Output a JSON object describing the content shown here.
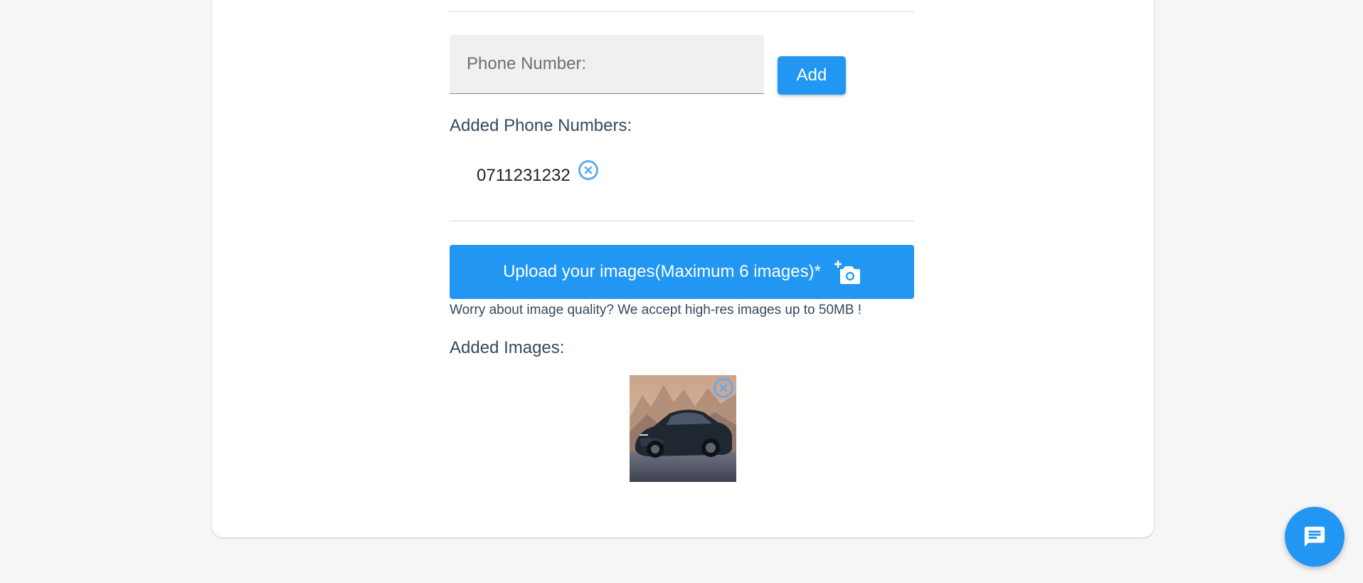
{
  "phone": {
    "placeholder": "Phone Number:",
    "value": "",
    "add_label": "Add"
  },
  "added_phones": {
    "label": "Added Phone Numbers:",
    "items": [
      "0711231232"
    ]
  },
  "upload": {
    "label": "Upload your images(Maximum 6 images)*",
    "hint": "Worry about image quality? We accept high-res images up to 50MB !"
  },
  "added_images": {
    "label": "Added Images:",
    "items": [
      "car-photo"
    ]
  },
  "icons": {
    "remove": "close-circle-icon",
    "upload": "add-a-photo-icon",
    "chat": "chat-icon"
  },
  "colors": {
    "primary": "#2196f3",
    "remove_icon": "#64a9f0",
    "label_text": "#34495e",
    "background": "#f6f6f6"
  }
}
